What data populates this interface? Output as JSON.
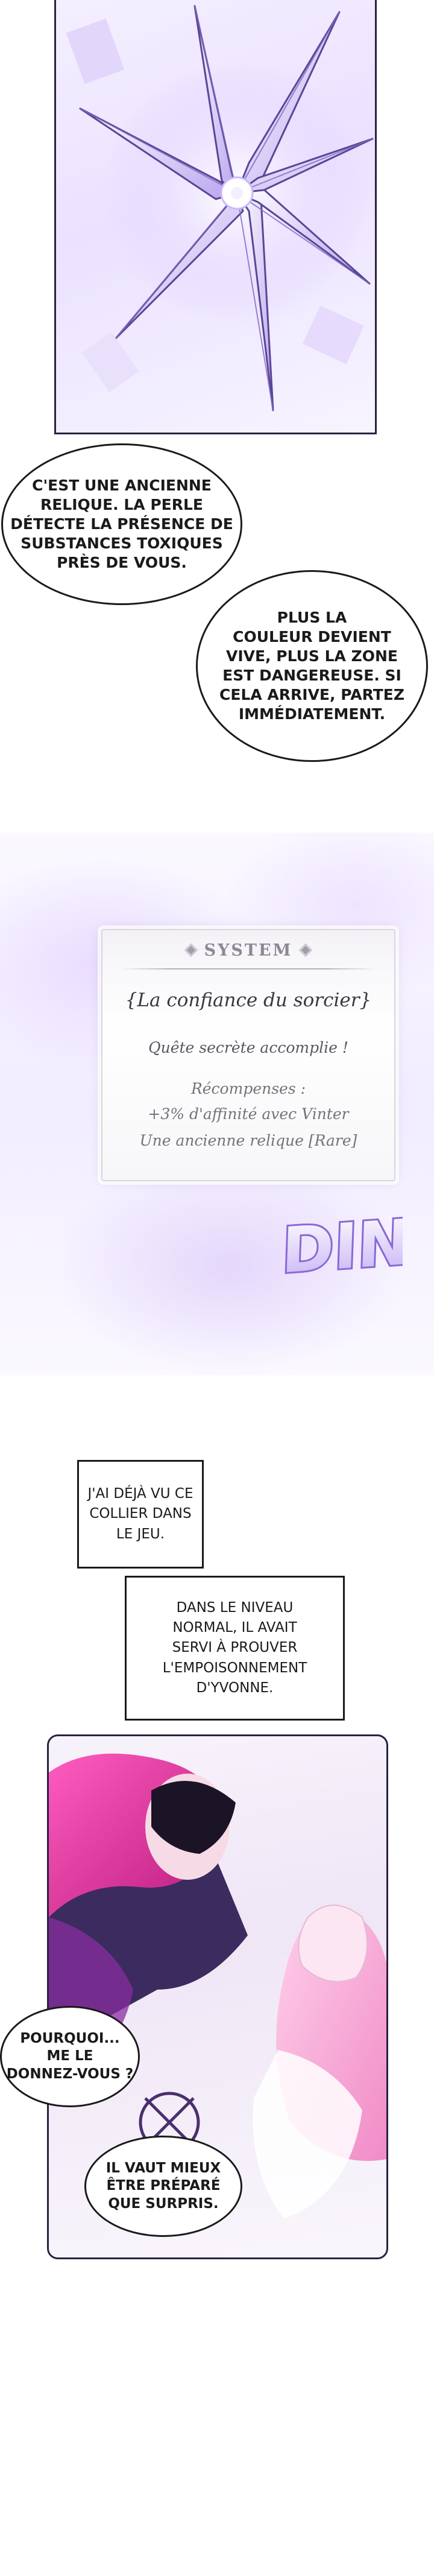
{
  "bubbles": {
    "relic_line1": "C'est une ancienne",
    "relic_line2": "relique. La perle",
    "relic_line3": "détecte la présence de",
    "relic_line4": "substances toxiques",
    "relic_line5": "près de vous.",
    "color_line1": "Plus la",
    "color_line2": "couleur devient",
    "color_line3": "vive, plus la zone",
    "color_line4": "est dangereuse. Si",
    "color_line5": "cela arrive, partez",
    "color_line6": "immédiatement.",
    "why_line1": "Pourquoi...",
    "why_line2": "me le",
    "why_line3": "donnez-vous ?",
    "better_line1": "Il vaut mieux",
    "better_line2": "être préparé",
    "better_line3": "que surpris."
  },
  "system": {
    "header": "SYSTEM",
    "quest_title": "{La confiance du sorcier}",
    "status": "Quête secrète accomplie !",
    "rewards_label": "Récompenses :",
    "reward_affinity": "+3% d'affinité avec Vinter",
    "reward_item": "Une ancienne relique [Rare]",
    "sound_effect": "DING"
  },
  "narration": {
    "seen_line1": "J'ai déjà vu ce",
    "seen_line2": "collier dans",
    "seen_line3": "le jeu.",
    "normal_line1": "Dans le niveau",
    "normal_line2": "normal, il avait",
    "normal_line3": "servi à prouver",
    "normal_line4": "l'empoisonnement",
    "normal_line5": "d'Yvonne."
  },
  "colors": {
    "purple_accent": "#9a7fe0",
    "magenta_hair": "#e0359a",
    "system_gray": "#8e8896",
    "ding_purple": "#8a68d6"
  }
}
